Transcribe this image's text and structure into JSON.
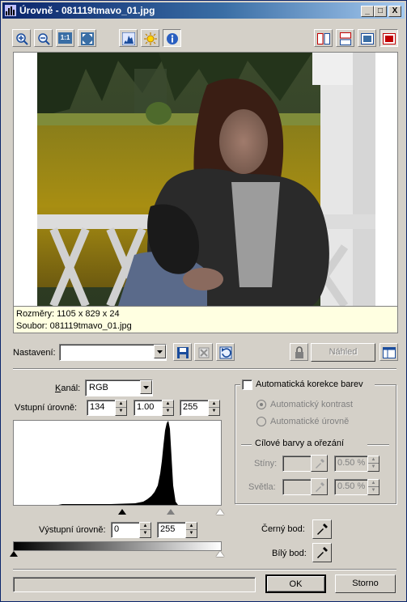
{
  "window": {
    "title": "Úrovně - 081119tmavo_01.jpg",
    "minimize": "_",
    "maximize": "□",
    "close": "X"
  },
  "toolbar": {
    "left_icons": [
      "zoom-in-icon",
      "zoom-out-icon",
      "actual-size-icon",
      "fit-window-icon",
      "histogram-icon",
      "brightness-icon",
      "info-icon"
    ],
    "actual_size_label": "1:1",
    "right_icons": [
      "split-vertical-icon",
      "split-horizontal-icon",
      "single-view-icon",
      "original-view-icon"
    ]
  },
  "preview": {
    "dimensions": "Rozměry: 1105 x 829 x 24",
    "file": "Soubor: 081119tmavo_01.jpg"
  },
  "preset": {
    "label": "Nastavení:",
    "value": "",
    "preview_button": "Náhled"
  },
  "levels": {
    "channel_label": "Kanál:",
    "channel_value": "RGB",
    "input_label": "Vstupní úrovně:",
    "input_black": "134",
    "input_gamma": "1.00",
    "input_white": "255",
    "output_label": "Výstupní úrovně:",
    "output_black": "0",
    "output_white": "255"
  },
  "auto": {
    "checkbox_label": "Automatická korekce barev",
    "contrast_label": "Automatický kontrast",
    "levels_label": "Automatické úrovně",
    "target_group": "Cílové barvy a ořezání",
    "shadows_label": "Stíny:",
    "shadows_value": "0.50 %",
    "highlights_label": "Světla:",
    "highlights_value": "0.50 %"
  },
  "points": {
    "black_label": "Černý bod:",
    "white_label": "Bílý bod:"
  },
  "footer": {
    "ok": "OK",
    "cancel": "Storno"
  },
  "colors": {
    "title_start": "#0a246a",
    "title_end": "#a6caf0",
    "face": "#d4d0c8",
    "info_bg": "#ffffe1"
  }
}
